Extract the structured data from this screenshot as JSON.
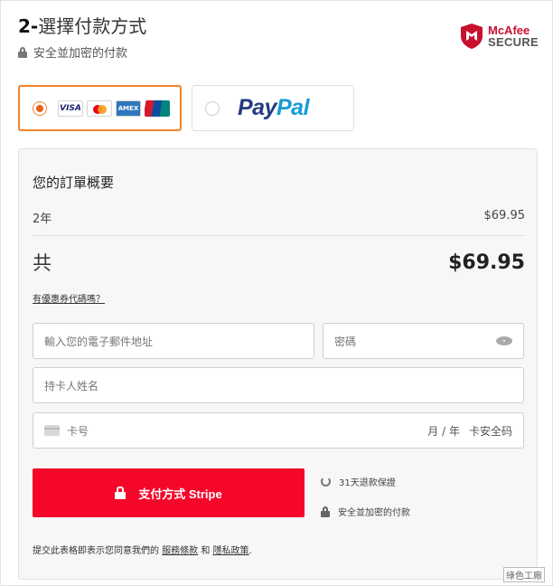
{
  "header": {
    "step_number": "2-",
    "step_title": "選擇付款方式",
    "secure_text": "安全並加密的付款"
  },
  "badge": {
    "line1": "McAfee",
    "line2": "SECURE"
  },
  "payment_options": {
    "card": {
      "brands": [
        "VISA",
        "Mastercard",
        "AMEX",
        "UnionPay"
      ],
      "visa_label": "VISA",
      "amex_label": "AMEX"
    },
    "paypal": {
      "part1": "Pay",
      "part2": "Pal"
    }
  },
  "summary": {
    "title": "您的訂單概要",
    "item_label": "2年",
    "item_price": "$69.95",
    "total_label": "共",
    "total_amount": "$69.95",
    "coupon_link": "有優惠券代碼嗎？"
  },
  "form": {
    "email_placeholder": "輸入您的電子郵件地址",
    "password_placeholder": "密碼",
    "name_placeholder": "持卡人姓名",
    "card_placeholder": "卡号",
    "expiry_placeholder": "月 / 年",
    "cvc_placeholder": "卡安全码"
  },
  "pay_button": {
    "label": "支付方式 Stripe"
  },
  "assurances": {
    "refund": "31天退款保證",
    "secure": "安全並加密的付款"
  },
  "terms": {
    "prefix": "提交此表格即表示您同意我們的 ",
    "tos": "服務條款",
    "and": " 和 ",
    "privacy": "隱私政策",
    "suffix": "."
  },
  "watermark": "綠色工廠",
  "colors": {
    "accent": "#f0832a",
    "pay_button": "#f5072a",
    "mcafee_red": "#c8102e"
  }
}
